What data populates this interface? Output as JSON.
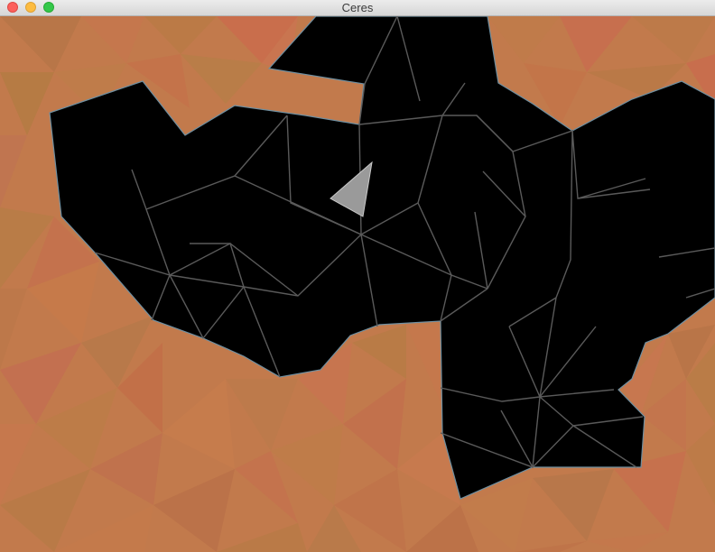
{
  "window": {
    "title": "Ceres"
  },
  "controls": {
    "close": "close",
    "minimize": "minimize",
    "zoom": "zoom"
  },
  "colors": {
    "terrain_base": "#c27a4c",
    "cave": "#000000",
    "mesh_lines": "#5a5a5a",
    "ship": "#9a9a9a",
    "edge_glow": "#6f8fa0"
  },
  "icons": {
    "ship": "triangle-ship-icon"
  }
}
